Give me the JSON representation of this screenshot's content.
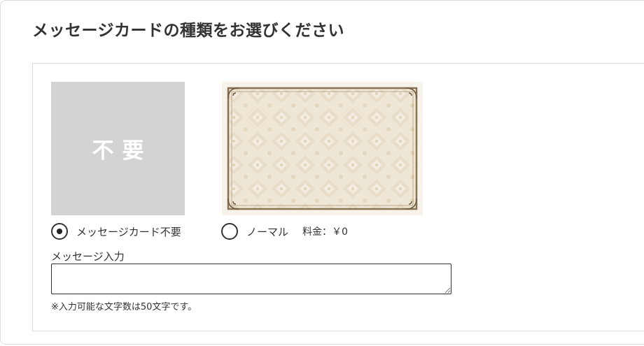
{
  "section": {
    "title": "メッセージカードの種類をお選びください"
  },
  "cards": {
    "none_image_text": "不要",
    "normal_image": "damask-card-icon"
  },
  "options": [
    {
      "label": "メッセージカード不要",
      "selected": true
    },
    {
      "label": "ノーマル",
      "price_label": "料金：￥0",
      "selected": false
    }
  ],
  "message": {
    "label": "メッセージ入力",
    "value": "",
    "placeholder": "",
    "note": "※入力可能な文字数は50文字です。"
  },
  "colors": {
    "text": "#333333",
    "placeholder_card": "#d3d3d3",
    "card_border": "#8b7355",
    "card_fill": "#efe6d4",
    "border": "#dcdcdc"
  }
}
